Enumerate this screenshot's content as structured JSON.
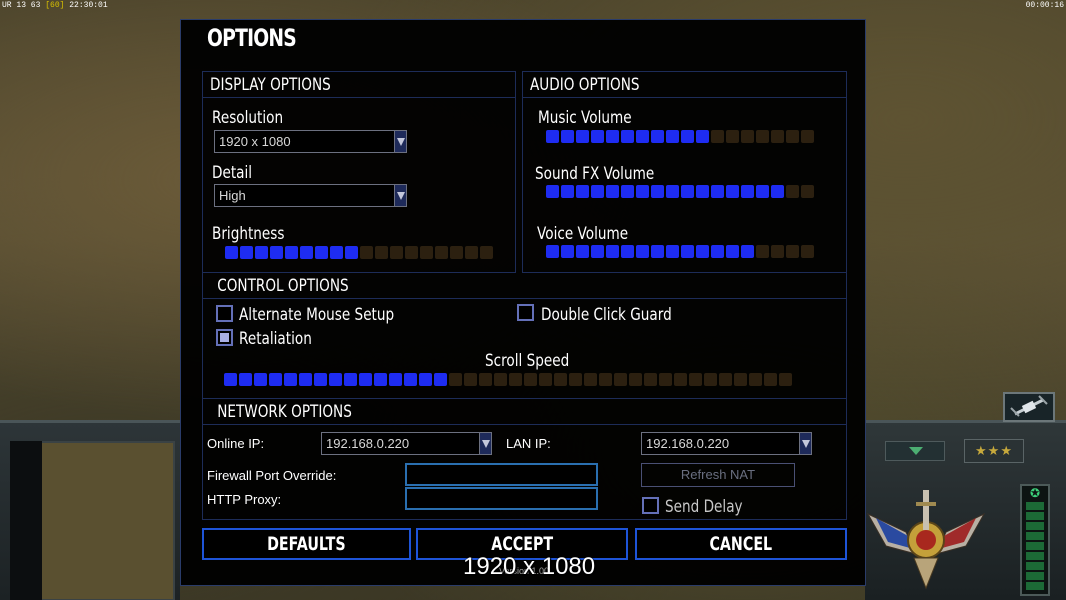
{
  "hud": {
    "left_prefix": "UR 13 63",
    "left_fps": "[60]",
    "left_time": "22:30:01",
    "right_time": "00:00:16"
  },
  "window": {
    "title": "OPTIONS"
  },
  "display": {
    "heading": "DISPLAY OPTIONS",
    "resolution_label": "Resolution",
    "resolution_value": "1920 x 1080",
    "detail_label": "Detail",
    "detail_value": "High",
    "brightness_label": "Brightness",
    "brightness_level": 0.5
  },
  "audio": {
    "heading": "AUDIO OPTIONS",
    "music_label": "Music Volume",
    "music_level": 0.6,
    "sfx_label": "Sound FX Volume",
    "sfx_level": 0.9,
    "voice_label": "Voice Volume",
    "voice_level": 0.75
  },
  "control": {
    "heading": "CONTROL OPTIONS",
    "alt_mouse_label": "Alternate Mouse Setup",
    "alt_mouse_checked": false,
    "double_click_label": "Double Click Guard",
    "double_click_checked": false,
    "retaliation_label": "Retaliation",
    "retaliation_checked": true,
    "scroll_label": "Scroll Speed",
    "scroll_level": 0.4
  },
  "network": {
    "heading": "NETWORK OPTIONS",
    "online_ip_label": "Online IP:",
    "online_ip_value": "192.168.0.220",
    "lan_ip_label": "LAN IP:",
    "lan_ip_value": "192.168.0.220",
    "firewall_label": "Firewall Port Override:",
    "firewall_value": "",
    "proxy_label": "HTTP Proxy:",
    "proxy_value": "",
    "refresh_nat_label": "Refresh NAT",
    "send_delay_label": "Send Delay",
    "send_delay_checked": false
  },
  "buttons": {
    "defaults": "DEFAULTS",
    "accept": "ACCEPT",
    "cancel": "CANCEL"
  },
  "version_text": "Version 1.00",
  "overlay_resolution": "1920 x 1080",
  "colors": {
    "slider_on": "#1e2cf2",
    "slider_off": "#2c2010",
    "border": "#1d2c58",
    "button_border": "#1e54d8"
  }
}
